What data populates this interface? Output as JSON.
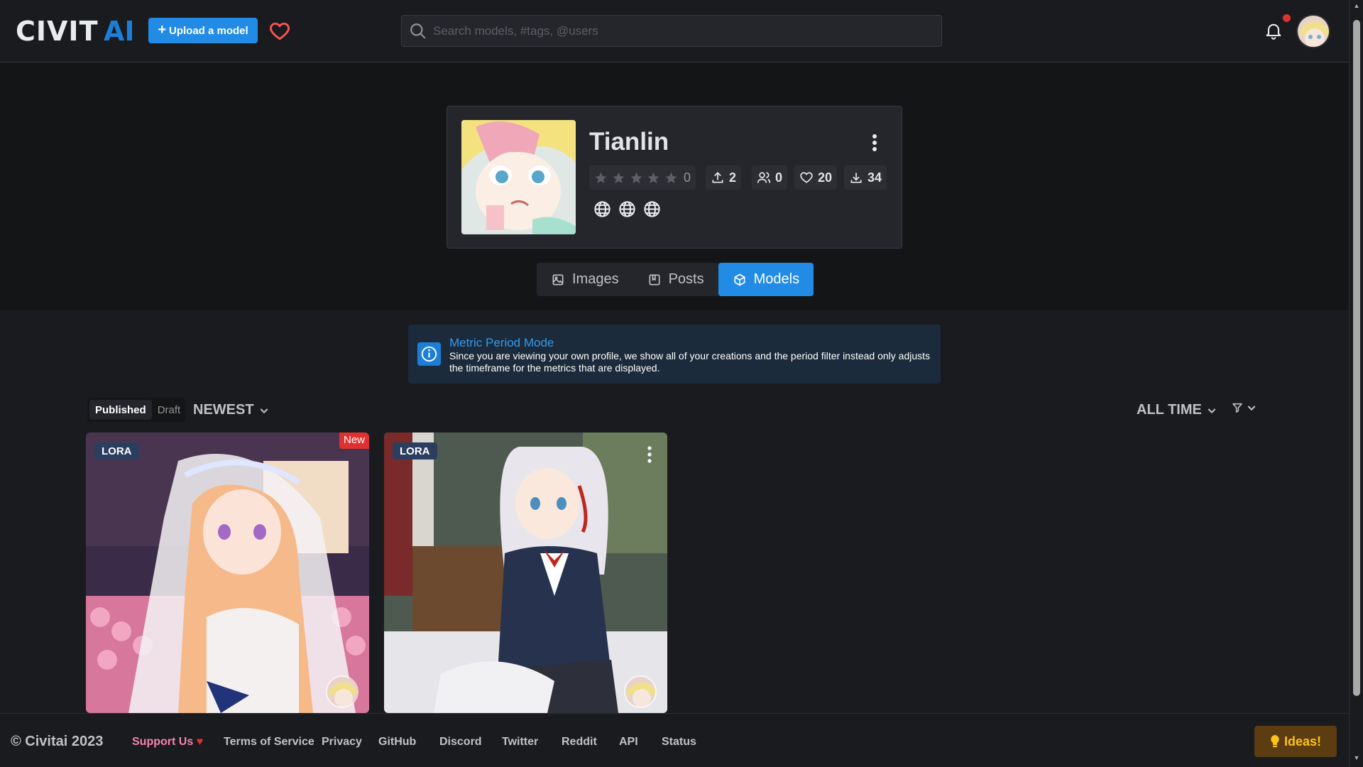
{
  "header": {
    "logo_text": "CIVITAI",
    "upload_label": "Upload a model",
    "search_placeholder": "Search models, #tags, @users"
  },
  "profile": {
    "name": "Tianlin",
    "rating_count": "0",
    "uploads": "2",
    "followers": "0",
    "likes": "20",
    "downloads": "34"
  },
  "tabs": [
    {
      "label": "Images"
    },
    {
      "label": "Posts"
    },
    {
      "label": "Models"
    }
  ],
  "alert": {
    "title": "Metric Period Mode",
    "body": "Since you are viewing your own profile, we show all of your creations and the period filter instead only adjusts the timeframe for the metrics that are displayed."
  },
  "controls": {
    "published": "Published",
    "draft": "Draft",
    "sort": "NEWEST",
    "period": "ALL TIME"
  },
  "cards": [
    {
      "badge": "LORA",
      "new_label": "New"
    },
    {
      "badge": "LORA"
    }
  ],
  "footer": {
    "copyright": "© Civitai 2023",
    "links": [
      "Support Us",
      "Terms of Service",
      "Privacy",
      "GitHub",
      "Discord",
      "Twitter",
      "Reddit",
      "API",
      "Status"
    ],
    "ideas": "Ideas!"
  },
  "colors": {
    "accent": "#228be6",
    "background": "#1a1b1e",
    "notification": "#e03131"
  }
}
